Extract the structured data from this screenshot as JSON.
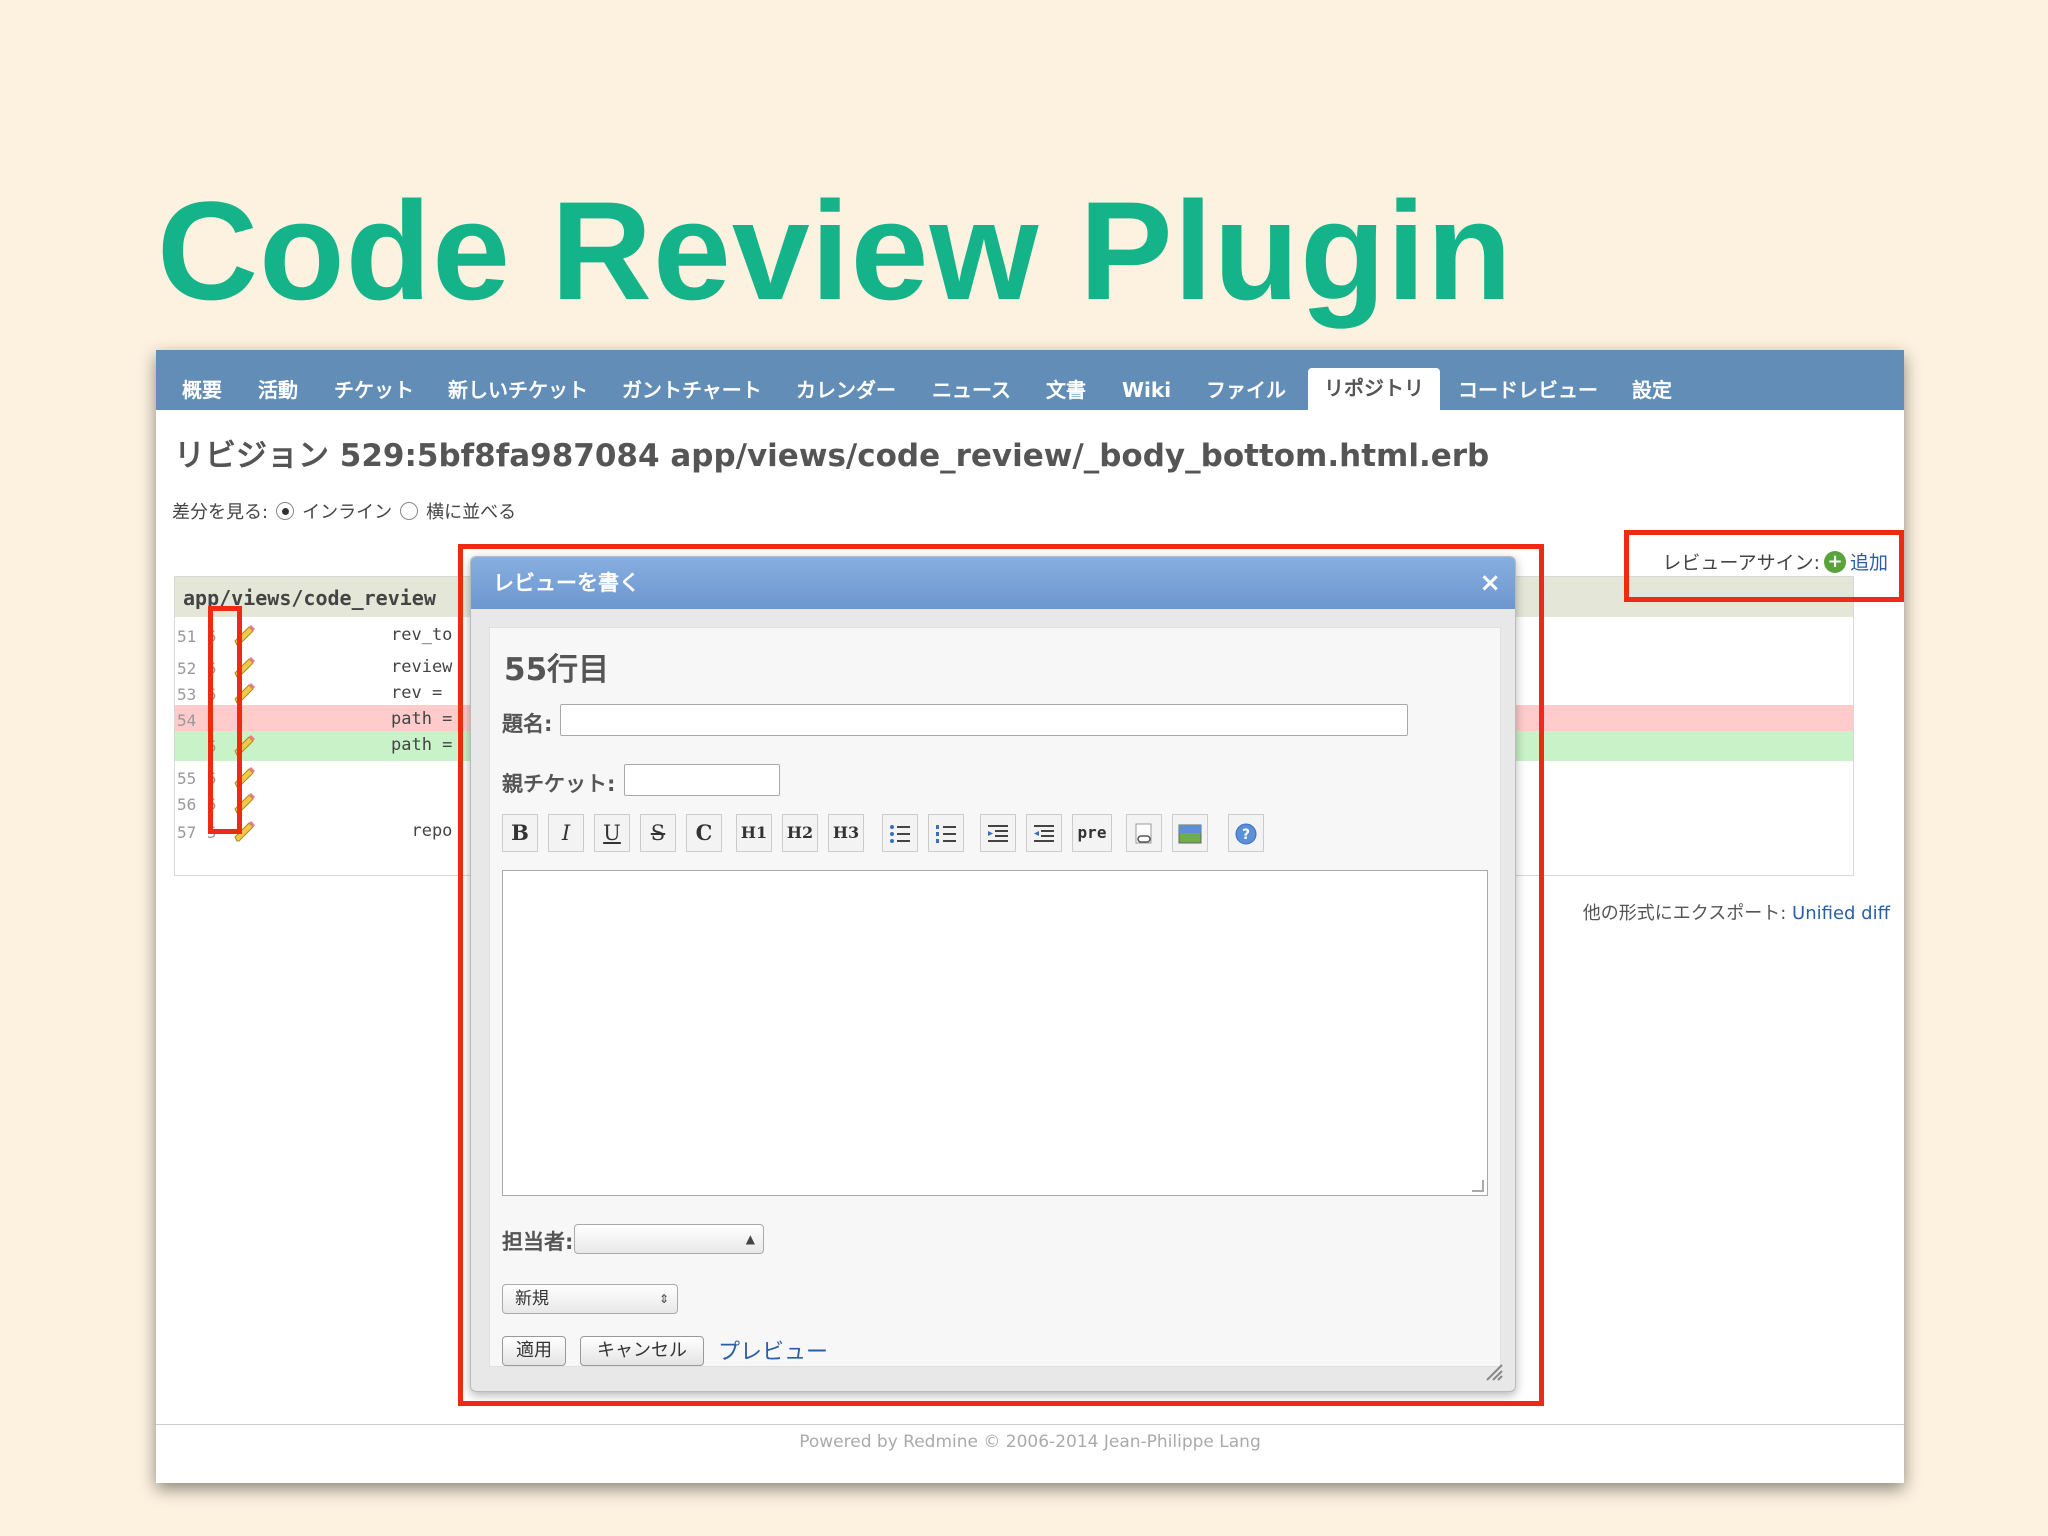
{
  "slide": {
    "title": "Code Review Plugin"
  },
  "tabs": [
    {
      "label": "概要"
    },
    {
      "label": "活動"
    },
    {
      "label": "チケット"
    },
    {
      "label": "新しいチケット"
    },
    {
      "label": "ガントチャート"
    },
    {
      "label": "カレンダー"
    },
    {
      "label": "ニュース"
    },
    {
      "label": "文書"
    },
    {
      "label": "Wiki"
    },
    {
      "label": "ファイル"
    },
    {
      "label": "リポジトリ",
      "active": true
    },
    {
      "label": "コードレビュー"
    },
    {
      "label": "設定"
    }
  ],
  "revision_title": "リビジョン 529:5bf8fa987084 app/views/code_review/_body_bottom.html.erb",
  "view_mode": {
    "label": "差分を見る:",
    "option_inline": "インライン",
    "option_side": "横に並べる",
    "selected": "inline"
  },
  "review_assign": {
    "label": "レビューアサイン:",
    "add_link": "追加"
  },
  "diff": {
    "file_header": "app/views/code_review",
    "rows": [
      {
        "old": "51",
        "new": "5",
        "code": "rev_to",
        "type": "ctx",
        "pencil": true
      },
      {
        "old": "52",
        "new": "5",
        "code": "review",
        "type": "ctx",
        "pencil": true
      },
      {
        "old": "53",
        "new": "5",
        "code": "rev =",
        "type": "ctx",
        "pencil": true
      },
      {
        "old": "54",
        "new": "",
        "code": "path =",
        "type": "del",
        "pencil": false
      },
      {
        "old": "",
        "new": "5",
        "code": "path =",
        "type": "add",
        "pencil": true
      },
      {
        "old": "55",
        "new": "5",
        "code": "",
        "type": "ctx",
        "pencil": true
      },
      {
        "old": "56",
        "new": "5",
        "code": "",
        "type": "ctx",
        "pencil": true
      },
      {
        "old": "57",
        "new": "5",
        "code": "  repo",
        "type": "ctx",
        "pencil": true
      }
    ]
  },
  "export": {
    "label": "他の形式にエクスポート:",
    "link": "Unified diff"
  },
  "footer": {
    "text": "Powered by Redmine © 2006-2014 Jean-Philippe Lang"
  },
  "dialog": {
    "title": "レビューを書く",
    "heading": "55行目",
    "subject_label": "題名:",
    "subject_value": "",
    "parent_label": "親チケット:",
    "parent_value": "",
    "toolbar": [
      "B",
      "I",
      "U",
      "S",
      "C",
      "H1",
      "H2",
      "H3",
      "ul",
      "ol",
      "indent-left",
      "indent-right",
      "pre",
      "link",
      "image",
      "help"
    ],
    "toolbar_pre": "pre",
    "assignee_label": "担当者:",
    "assignee_value": "",
    "status_value": "新規",
    "apply_button": "適用",
    "cancel_button": "キャンセル",
    "preview_link": "プレビュー"
  },
  "colors": {
    "title": "#14b38a",
    "tabbar": "#628db6",
    "highlight": "#ee2a12",
    "background": "#fdf2e0"
  }
}
